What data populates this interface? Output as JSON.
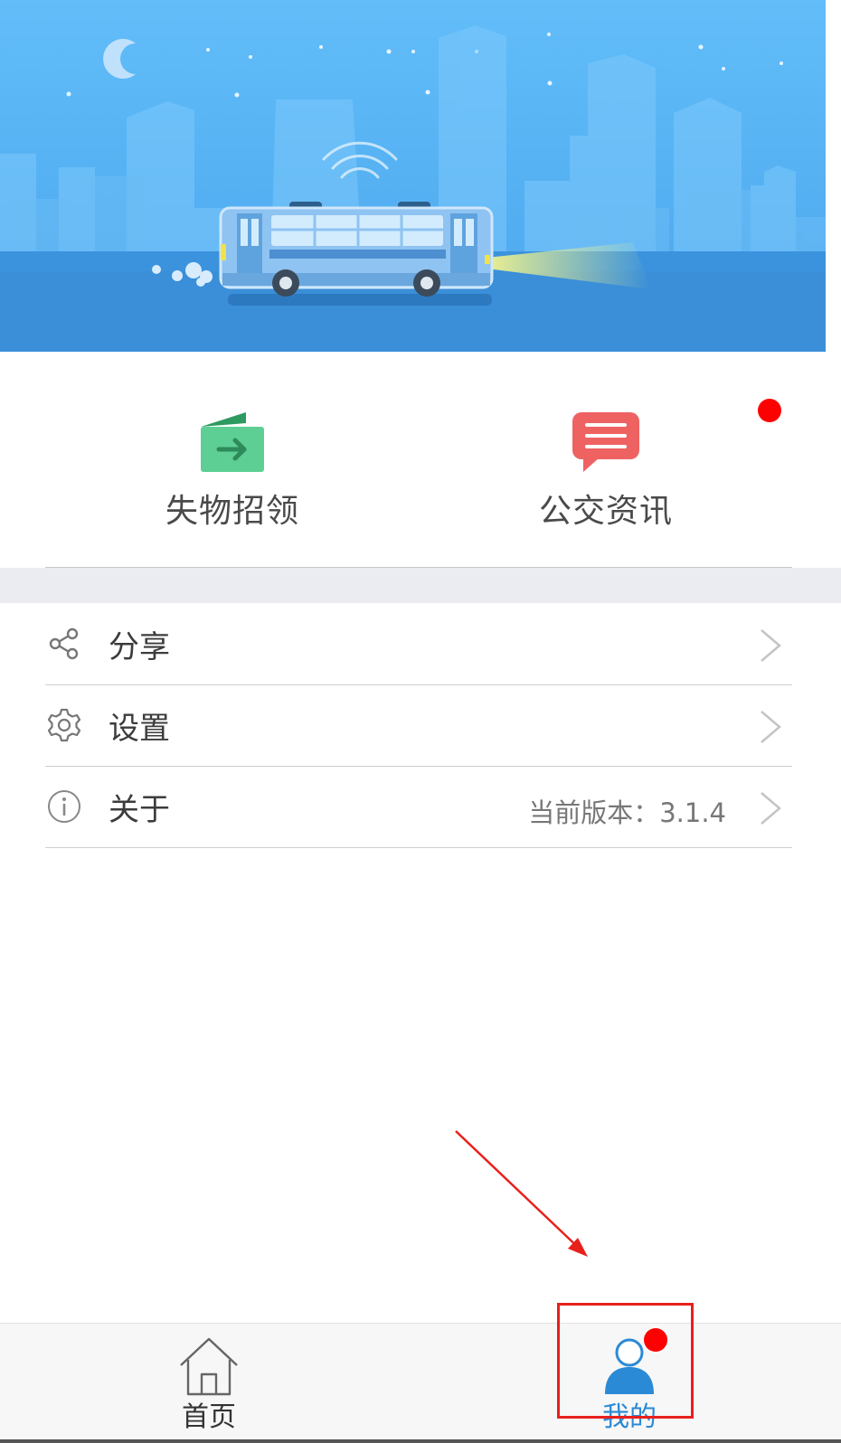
{
  "grid": {
    "lost_found": {
      "label": "失物招领",
      "icon": "wallet-arrow-icon",
      "color": "#5dcf95"
    },
    "bus_news": {
      "label": "公交资讯",
      "icon": "message-bubble-icon",
      "color": "#ee6262",
      "has_badge": true
    }
  },
  "menu": {
    "share": {
      "label": "分享",
      "icon": "share-icon"
    },
    "settings": {
      "label": "设置",
      "icon": "gear-icon"
    },
    "about": {
      "label": "关于",
      "icon": "info-icon",
      "value": "当前版本：3.1.4"
    }
  },
  "tabbar": {
    "home": {
      "label": "首页",
      "icon": "home-icon"
    },
    "mine": {
      "label": "我的",
      "icon": "user-icon",
      "active": true,
      "has_badge": true,
      "active_color": "#2b8ad6"
    }
  },
  "colors": {
    "banner_top": "#62bdf9",
    "banner_bottom": "#3a93dd",
    "badge": "#ff0000",
    "annotation": "#e8201c"
  }
}
